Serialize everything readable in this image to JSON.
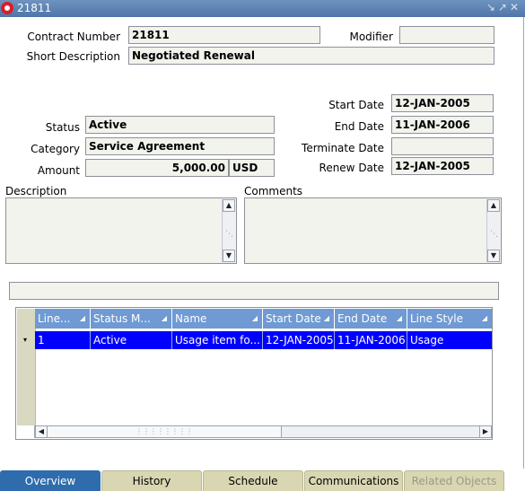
{
  "window": {
    "title": "21811"
  },
  "labels": {
    "contract_number": "Contract Number",
    "modifier": "Modifier",
    "short_description": "Short Description",
    "start_date": "Start Date",
    "status": "Status",
    "end_date": "End Date",
    "category": "Category",
    "terminate_date": "Terminate Date",
    "amount": "Amount",
    "renew_date": "Renew Date",
    "description": "Description",
    "comments": "Comments"
  },
  "values": {
    "contract_number": "21811",
    "modifier": "",
    "short_description": "Negotiated Renewal",
    "start_date": "12-JAN-2005",
    "status": "Active",
    "end_date": "11-JAN-2006",
    "category": "Service Agreement",
    "terminate_date": "",
    "amount": "5,000.00",
    "currency": "USD",
    "renew_date": "12-JAN-2005",
    "description": "",
    "comments": ""
  },
  "lines_table": {
    "columns": [
      "Line...",
      "Status M...",
      "Name",
      "Start Date",
      "End Date",
      "Line Style"
    ],
    "rows": [
      {
        "line": "1",
        "status": "Active",
        "name": "Usage item fo...",
        "start_date": "12-JAN-2005",
        "end_date": "11-JAN-2006",
        "line_style": "Usage"
      }
    ]
  },
  "tabs": [
    {
      "label": "Overview",
      "state": "active"
    },
    {
      "label": "History",
      "state": "normal"
    },
    {
      "label": "Schedule",
      "state": "normal"
    },
    {
      "label": "Communications",
      "state": "normal"
    },
    {
      "label": "Related Objects",
      "state": "disabled"
    }
  ],
  "icons": {
    "app": "oracle-logo-icon",
    "window_buttons": [
      "minimize-icon",
      "maximize-icon",
      "close-icon"
    ]
  },
  "colors": {
    "title_bar": "#5b82b4",
    "header": "#6f9ad3",
    "selected_row": "#0000ff",
    "active_tab": "#2f6cad",
    "tab": "#d8d7b2"
  }
}
